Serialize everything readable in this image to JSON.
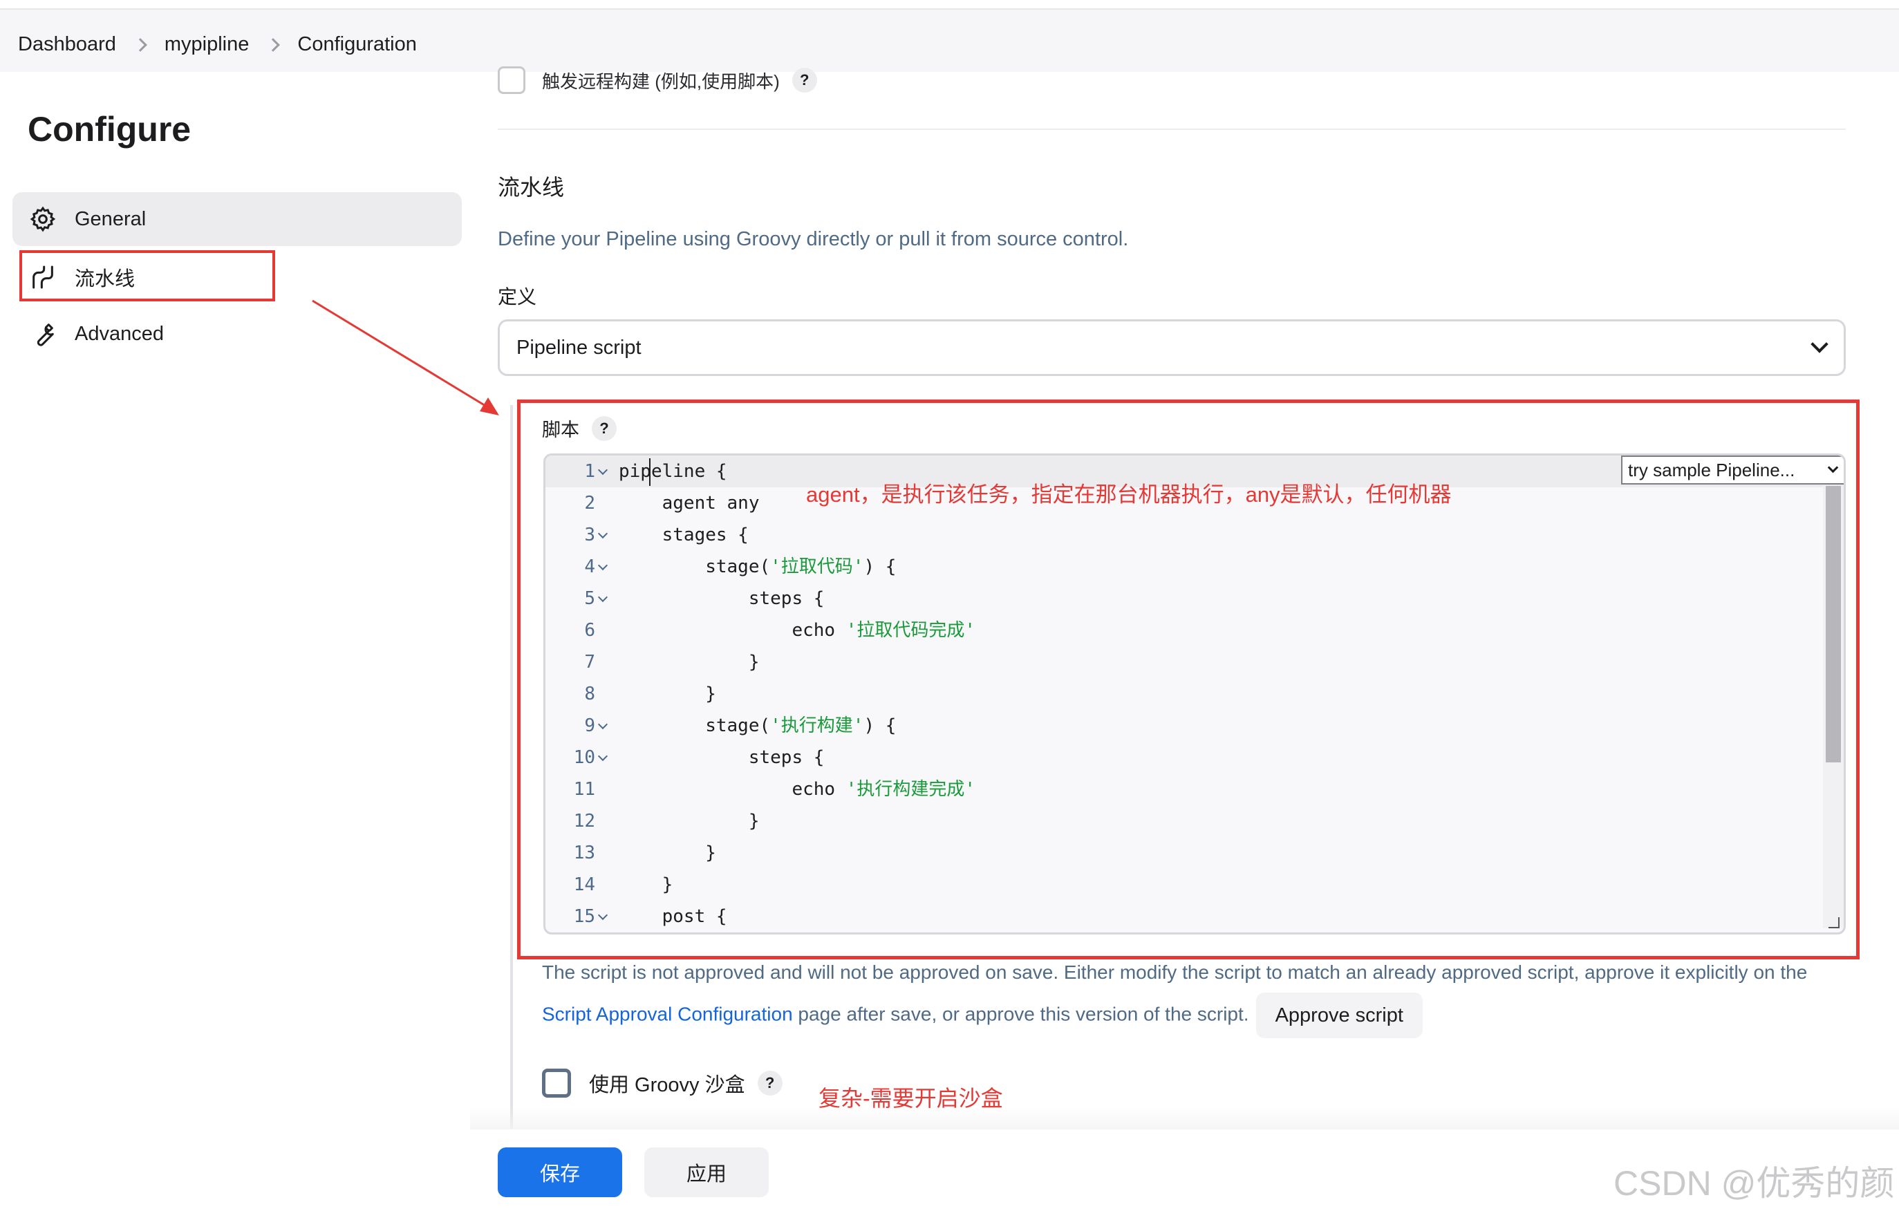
{
  "breadcrumb": [
    "Dashboard",
    "mypipline",
    "Configuration"
  ],
  "page_title": "Configure",
  "sidebar": {
    "items": [
      {
        "label": "General",
        "icon": "gear-icon",
        "active": true
      },
      {
        "label": "流水线",
        "icon": "pipeline-icon",
        "active": false
      },
      {
        "label": "Advanced",
        "icon": "wrench-icon",
        "active": false
      }
    ]
  },
  "trigger": {
    "label": "触发远程构建 (例如,使用脚本)",
    "help": "?"
  },
  "pipeline_section": {
    "title": "流水线",
    "description": "Define your Pipeline using Groovy directly or pull it from source control.",
    "definition_label": "定义",
    "definition_value": "Pipeline script",
    "script_label": "脚本",
    "script_help": "?",
    "try_sample": "try sample Pipeline..."
  },
  "code_lines": [
    {
      "num": "1",
      "fold": true,
      "text": "pipeline {"
    },
    {
      "num": "2",
      "fold": false,
      "text": "    agent any"
    },
    {
      "num": "3",
      "fold": true,
      "text": "    stages {"
    },
    {
      "num": "4",
      "fold": true,
      "pre": "        stage(",
      "str": "'拉取代码'",
      "post": ") {"
    },
    {
      "num": "5",
      "fold": true,
      "text": "            steps {"
    },
    {
      "num": "6",
      "fold": false,
      "pre": "                echo ",
      "str": "'拉取代码完成'",
      "post": ""
    },
    {
      "num": "7",
      "fold": false,
      "text": "            }"
    },
    {
      "num": "8",
      "fold": false,
      "text": "        }"
    },
    {
      "num": "9",
      "fold": true,
      "pre": "        stage(",
      "str": "'执行构建'",
      "post": ") {"
    },
    {
      "num": "10",
      "fold": true,
      "text": "            steps {"
    },
    {
      "num": "11",
      "fold": false,
      "pre": "                echo ",
      "str": "'执行构建完成'",
      "post": ""
    },
    {
      "num": "12",
      "fold": false,
      "text": "            }"
    },
    {
      "num": "13",
      "fold": false,
      "text": "        }"
    },
    {
      "num": "14",
      "fold": false,
      "text": "    }"
    },
    {
      "num": "15",
      "fold": true,
      "text": "    post {"
    }
  ],
  "annotations": {
    "agent": "agent，是执行该任务，指定在那台机器执行，any是默认，任何机器",
    "sandbox": "复杂-需要开启沙盒"
  },
  "approval": {
    "text_before": "The script is not approved and will not be approved on save. Either modify the script to match an already approved script, approve it explicitly on the ",
    "link": "Script Approval Configuration",
    "text_after": " page after save, or approve this version of the script.",
    "button": "Approve script"
  },
  "groovy_sandbox": {
    "label": "使用 Groovy 沙盒",
    "help": "?"
  },
  "buttons": {
    "save": "保存",
    "apply": "应用"
  },
  "watermark": "CSDN @优秀的颜",
  "colors": {
    "accent": "#1a73e8",
    "annotation": "#e53935",
    "code_string": "#1a9a3a",
    "link": "#1565d8"
  }
}
